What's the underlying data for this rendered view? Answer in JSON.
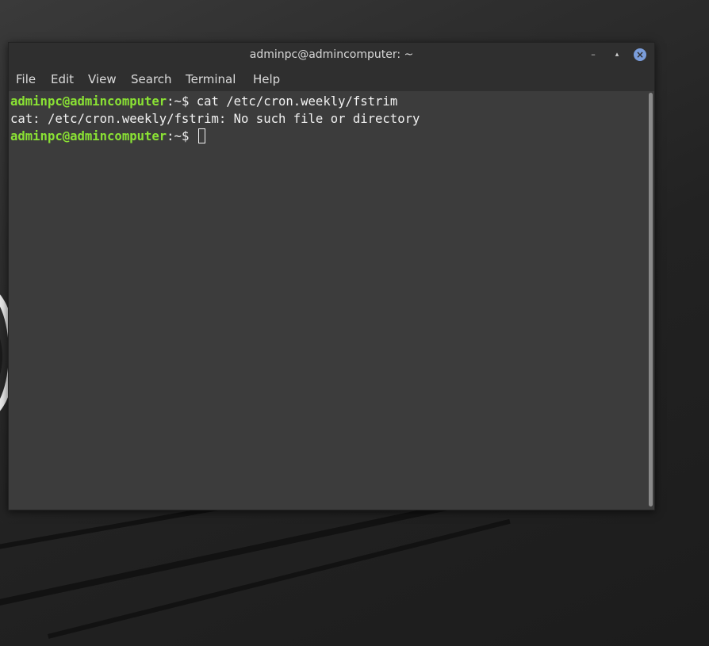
{
  "window": {
    "title": "adminpc@admincomputer: ~",
    "minimize_icon": "minimize-icon",
    "maximize_icon": "maximize-icon",
    "close_icon": "close-icon",
    "accent_color": "#7a9ddb"
  },
  "menu": {
    "items": [
      "File",
      "Edit",
      "View",
      "Search",
      "Terminal",
      "Help"
    ]
  },
  "terminal": {
    "prompt_color": "#8ae234",
    "lines": [
      {
        "user": "adminpc@admincomputer",
        "path": ":~",
        "symbol": "$ ",
        "command": "cat /etc/cron.weekly/fstrim"
      },
      {
        "output": "cat: /etc/cron.weekly/fstrim: No such file or directory"
      },
      {
        "user": "adminpc@admincomputer",
        "path": ":~",
        "symbol": "$ ",
        "command": ""
      }
    ]
  }
}
